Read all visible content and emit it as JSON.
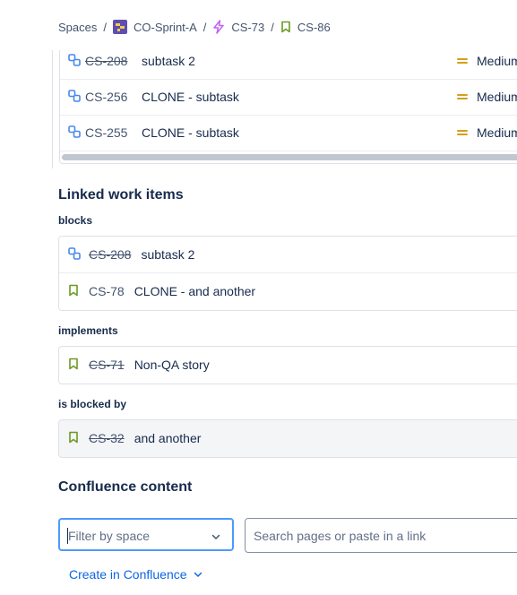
{
  "breadcrumbs": [
    {
      "label": "Spaces",
      "icon": null
    },
    {
      "label": "CO-Sprint-A",
      "icon": "project-avatar-icon"
    },
    {
      "label": "CS-73",
      "icon": "epic-lightning-icon"
    },
    {
      "label": "CS-86",
      "icon": "story-bookmark-icon"
    }
  ],
  "subtasks": [
    {
      "key": "CS-208",
      "done": true,
      "summary": "subtask 2",
      "priority": "Medium",
      "icon": "subtask-icon"
    },
    {
      "key": "CS-256",
      "done": false,
      "summary": "CLONE - subtask",
      "priority": "Medium",
      "icon": "subtask-icon"
    },
    {
      "key": "CS-255",
      "done": false,
      "summary": "CLONE - subtask",
      "priority": "Medium",
      "icon": "subtask-icon"
    }
  ],
  "linked": {
    "title": "Linked work items",
    "groups": [
      {
        "label": "blocks",
        "items": [
          {
            "key": "CS-208",
            "done": true,
            "summary": "subtask 2",
            "icon": "subtask-icon"
          },
          {
            "key": "CS-78",
            "done": false,
            "summary": "CLONE - and another",
            "icon": "story-bookmark-icon"
          }
        ]
      },
      {
        "label": "implements",
        "items": [
          {
            "key": "CS-71",
            "done": true,
            "summary": "Non-QA story",
            "icon": "story-bookmark-icon"
          }
        ]
      },
      {
        "label": "is blocked by",
        "items": [
          {
            "key": "CS-32",
            "done": true,
            "summary": "and another",
            "icon": "story-bookmark-icon"
          }
        ]
      }
    ]
  },
  "confluence": {
    "title": "Confluence content",
    "filter_placeholder": "Filter by space",
    "search_placeholder": "Search pages or paste in a link",
    "create_label": "Create in Confluence"
  },
  "colors": {
    "accent": "#0c66e4",
    "story": "#6a9a23",
    "subtask": "#4688ec",
    "epic": "#bf63f3",
    "priority_medium": "#d4a017",
    "focus": "#4c9aff"
  }
}
